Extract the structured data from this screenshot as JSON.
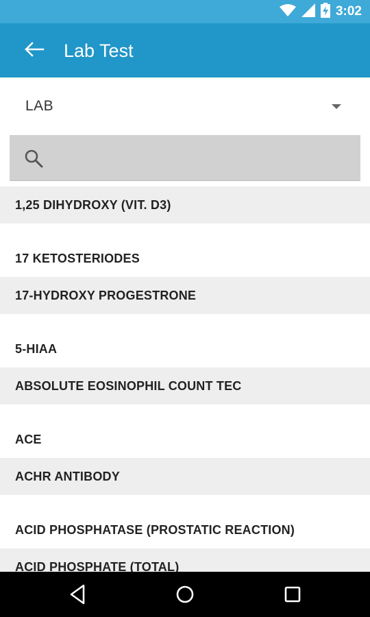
{
  "status_bar": {
    "time": "3:02",
    "icons": [
      "wifi-icon",
      "cell-signal-icon",
      "battery-charging-icon"
    ]
  },
  "app_bar": {
    "title": "Lab Test",
    "back_icon": "arrow-back-icon"
  },
  "dropdown": {
    "selected": "LAB",
    "icon": "dropdown-arrow-icon"
  },
  "search": {
    "placeholder": "",
    "value": "",
    "icon": "search-icon"
  },
  "list": {
    "items": [
      "1,25 DIHYDROXY (VIT. D3)",
      "17 KETOSTERIODES",
      "17-HYDROXY PROGESTRONE",
      "5-HIAA",
      "ABSOLUTE EOSINOPHIL COUNT TEC",
      "ACE",
      "ACHR ANTIBODY",
      "ACID PHOSPHATASE (PROSTATIC REACTION)",
      "ACID PHOSPHATE (TOTAL)"
    ]
  },
  "nav_bar": {
    "buttons": [
      "back-triangle-icon",
      "home-circle-icon",
      "recents-square-icon"
    ]
  },
  "colors": {
    "status_bar": "#3fa9d8",
    "app_bar": "#2196c8",
    "search_bg": "#d1d1d1",
    "row_shaded": "#eeeeee"
  }
}
